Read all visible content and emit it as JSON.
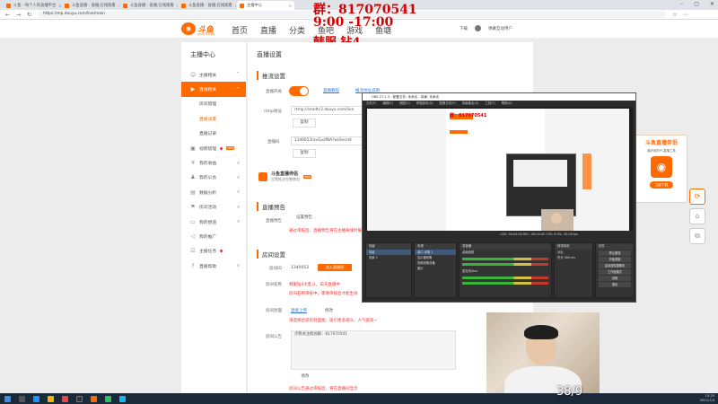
{
  "browser": {
    "tabs": [
      {
        "label": "斗鱼 - 每个人的直播平台"
      },
      {
        "label": "斗鱼直播 - 直播,在线观看"
      },
      {
        "label": "斗鱼直播 - 直播,在线观看"
      },
      {
        "label": "斗鱼直播 - 直播,在线观看"
      },
      {
        "label": "主播中心"
      }
    ],
    "url": "https://mp.douyu.com/live/main"
  },
  "overlay": {
    "group": "群：817070541",
    "hours": "9:00 -17:00",
    "rank": "韩服 钻4",
    "counter": "38/9"
  },
  "header": {
    "logo": "斗鱼",
    "logo_sub": "DOUYU.COM",
    "nav": [
      "首页",
      "直播",
      "分类",
      "鱼吧",
      "游戏",
      "鱼塘"
    ],
    "download": "下载",
    "user": "弹幕互动用户"
  },
  "sidebar": {
    "title": "主播中心",
    "items": [
      {
        "label": "主播相关",
        "icon": "user-icon"
      },
      {
        "label": "直播相关",
        "icon": "video-icon"
      },
      {
        "label": "房间管理"
      },
      {
        "label": "直播设置"
      },
      {
        "label": "直播记录"
      },
      {
        "label": "视频管理",
        "icon": "film-icon",
        "badge": "NEW"
      },
      {
        "label": "我的收益",
        "icon": "coin-icon"
      },
      {
        "label": "我的公会",
        "icon": "group-icon"
      },
      {
        "label": "数据分析",
        "icon": "chart-icon"
      },
      {
        "label": "房间活动",
        "icon": "flag-icon"
      },
      {
        "label": "我的频道",
        "icon": "tv-icon"
      },
      {
        "label": "我的推广",
        "icon": "megaphone-icon"
      },
      {
        "label": "主播任务",
        "icon": "task-icon"
      },
      {
        "label": "直播帮助",
        "icon": "help-icon"
      }
    ]
  },
  "main": {
    "page_title": "直播设置",
    "stream_section": "推流设置",
    "stream_switch_label": "直播开关",
    "stream_link1": "直播教程",
    "stream_link2": "推流地址说明",
    "rtmp_label": "rtmp地址",
    "rtmp_value": "rtmp://sendtc3.douyu.com/live",
    "copy_label": "复制",
    "code_label": "直播码",
    "code_value": "1340053ravGuzfNA?wsSecret",
    "assist_name": "斗鱼直播伴侣",
    "assist_desc": "设置推流完整教程",
    "assist_badge": "NEW",
    "notice_section": "直播预告",
    "notice_label": "直播预告",
    "notice_btn": "设置预告",
    "notice_tip": "通过审核后，直播预告将在主播离线时展示",
    "room_section": "房间设置",
    "room_id_label": "房间ID",
    "room_id": "1340053",
    "room_id_btn": "进入直播间",
    "room_name_label": "房间名称",
    "room_name_tip": "韩服钻4大乱斗，白天直播中",
    "room_name_tip2": "房间名称审核中，需要审核后才能生效",
    "cover_label": "房间封面",
    "cover_upload": "直接上传",
    "cover_modify": "修改",
    "cover_tip": "请选择合适的封面图，吸引更多观众，人气提高~",
    "announce_label": "房间公告",
    "announce_value": "点我关注群加群：817070541",
    "announce_modify": "修改",
    "announce_tip": "房间公告通过审核后，将在直播间显示"
  },
  "banner": {
    "title": "斗鱼直播伴侣",
    "desc": "最好用的PC直播工具",
    "btn": "立即下载"
  },
  "obs": {
    "title": "OBS 27.1.3 - 配置文件: 未命名 - 场景: 未命名",
    "menu": [
      "文件(F)",
      "编辑(E)",
      "视图(V)",
      "停靠部件(D)",
      "配置文件(P)",
      "场景集合(S)",
      "工具(T)",
      "帮助(H)"
    ],
    "status": "LIVE: 00:00:00   REC: 00:00:00   CPU: 6.0%, 30.00 fps",
    "docks": {
      "scenes": {
        "title": "场景",
        "items": [
          "场景",
          "场景 2"
        ]
      },
      "sources": {
        "title": "来源",
        "items": [
          "窗口 采集 2",
          "显示器采集",
          "视频采集设备",
          "图片"
        ]
      },
      "mixer": {
        "title": "混音器",
        "items": [
          "桌面音频",
          "麦克风/Aux"
        ]
      },
      "transitions": {
        "title": "转场特效",
        "items": [
          "淡出",
          "时长 300 ms"
        ]
      },
      "controls": {
        "title": "控件",
        "items": [
          "停止推流",
          "开始录制",
          "启动虚拟摄像机",
          "工作室模式",
          "设置",
          "退出"
        ]
      }
    }
  },
  "taskbar": {
    "time": "15:25",
    "date": "2021/7/4"
  }
}
